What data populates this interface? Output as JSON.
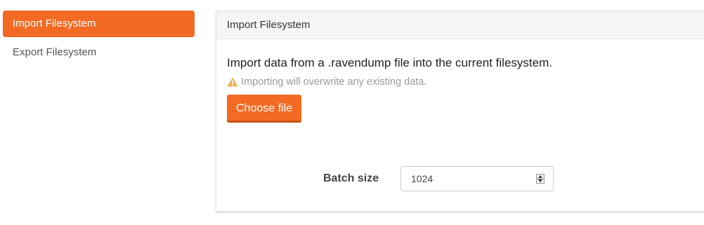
{
  "sidebar": {
    "items": [
      {
        "label": "Import Filesystem",
        "active": true
      },
      {
        "label": "Export Filesystem",
        "active": false
      }
    ]
  },
  "panel": {
    "title": "Import Filesystem",
    "description": "Import data from a .ravendump file into the current filesystem.",
    "warning_icon": "warning-triangle-icon",
    "warning_text": "Importing will overwrite any existing data.",
    "choose_file_label": "Choose file",
    "batch_size": {
      "label": "Batch size",
      "value": "1024"
    }
  },
  "colors": {
    "accent": "#f26a24",
    "warning_icon": "#f0ad4e"
  }
}
